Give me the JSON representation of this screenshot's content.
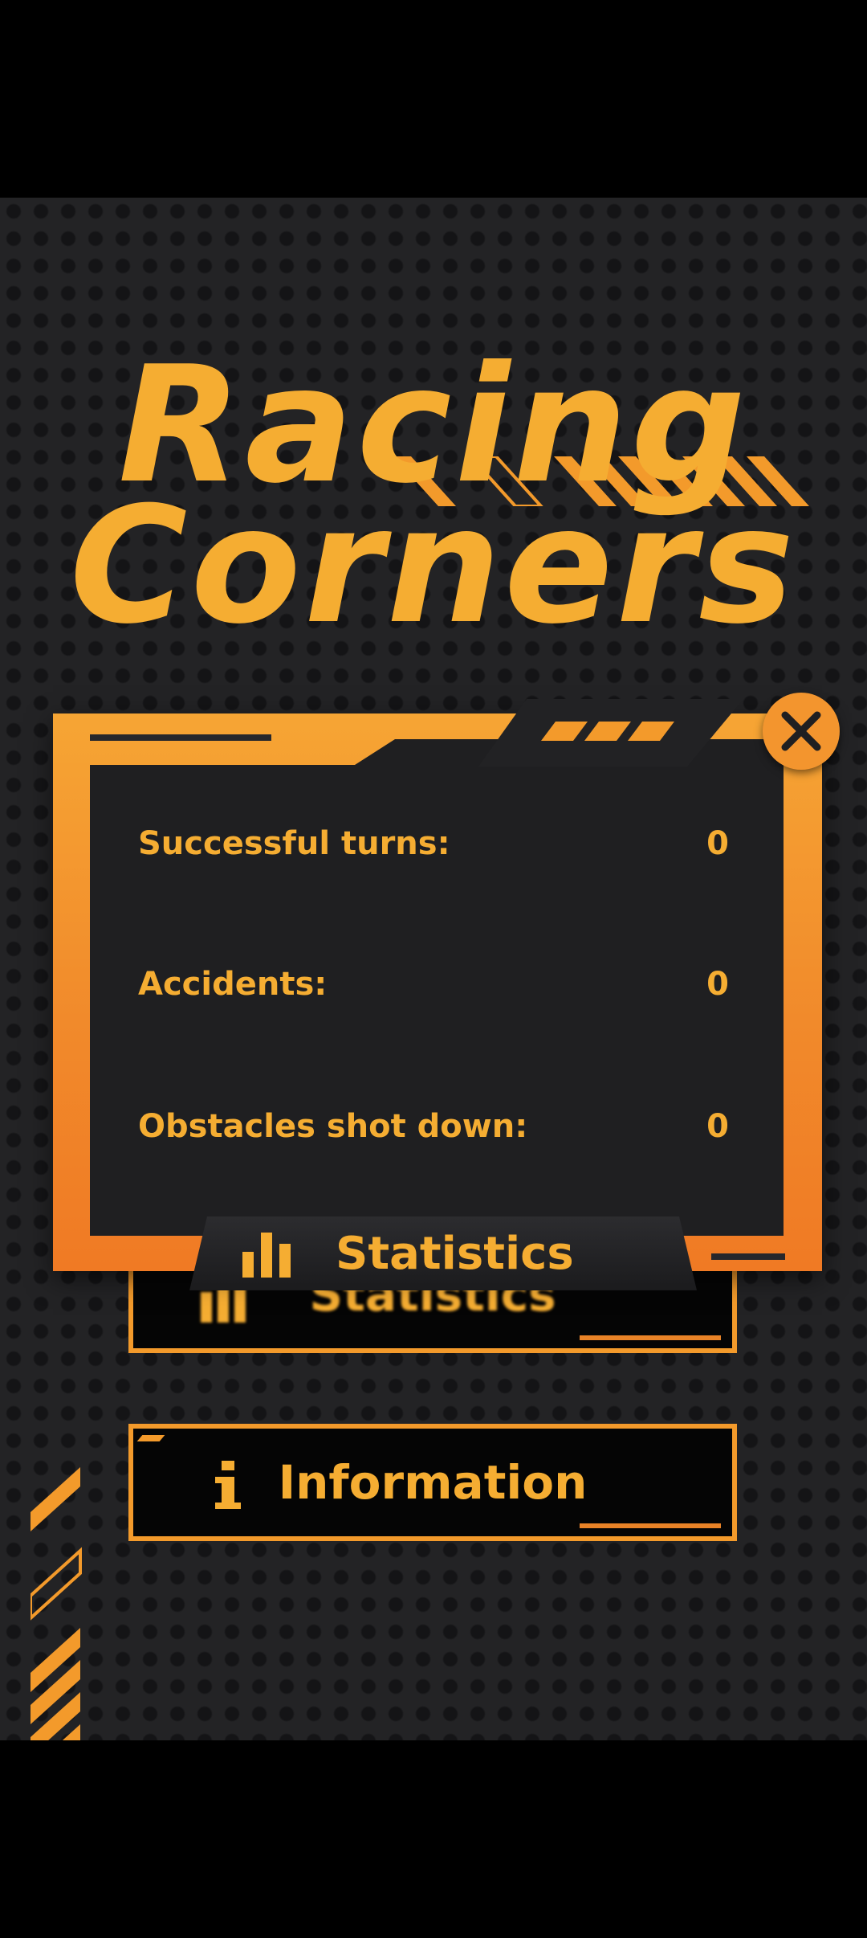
{
  "app": {
    "title_line1": "Racing",
    "title_line2": "Corners"
  },
  "menu": {
    "statistics_label": "Statistics",
    "information_label": "Information"
  },
  "dialog": {
    "tab_label": "Statistics",
    "rows": [
      {
        "label": "Successful turns:",
        "value": "0"
      },
      {
        "label": "Accidents:",
        "value": "0"
      },
      {
        "label": "Obstacles shot down:",
        "value": "0"
      }
    ]
  },
  "icons": {
    "close": "close-x-icon",
    "stats": "bar-chart-icon",
    "info": "info-icon"
  },
  "colors": {
    "accent": "#f5ad32",
    "frame": "#f18a2b",
    "panel": "#1f1f21",
    "background": "#232325"
  }
}
